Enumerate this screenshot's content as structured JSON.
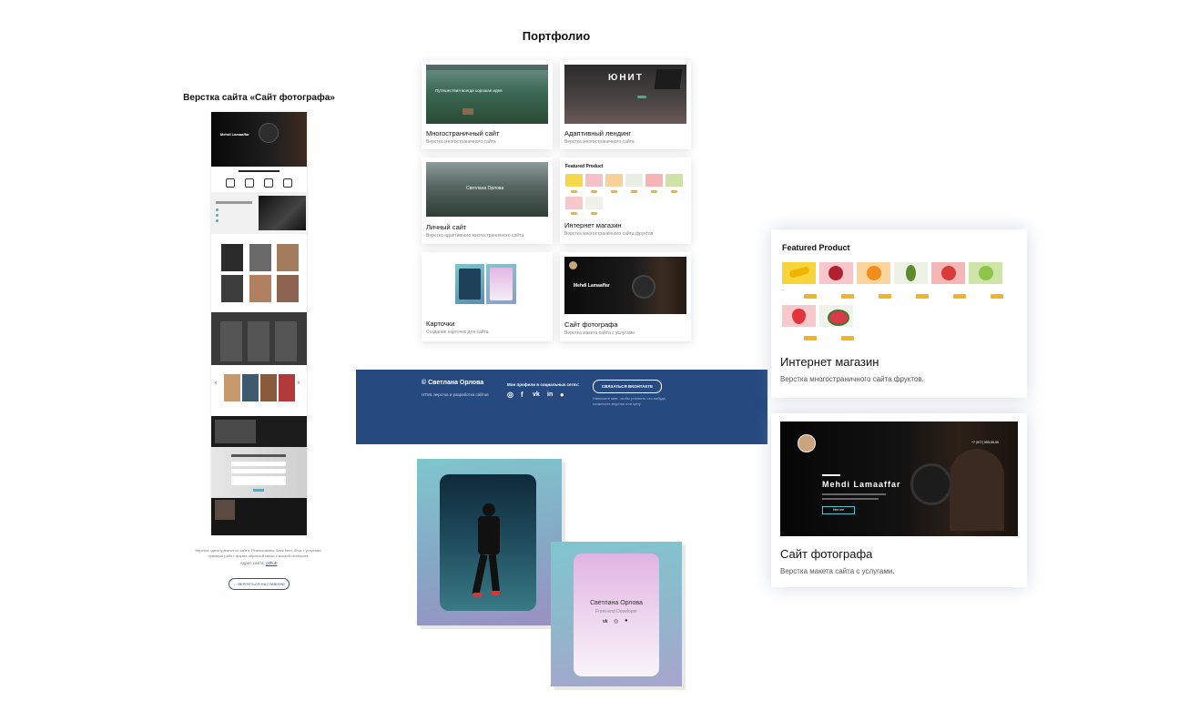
{
  "portfolio": {
    "title": "Портфолио",
    "cards": [
      {
        "title": "Многостраничный сайт",
        "subtitle": "Верстка многостраничного сайта",
        "thumb_text": "Путешествия всегда хорошая идея"
      },
      {
        "title": "Адаптивный лендинг",
        "subtitle": "Верстка многостраничного сайта",
        "thumb_text": "ЮНИТ"
      },
      {
        "title": "Личный сайт",
        "subtitle": "Верстка адаптивного многостраничного сайта",
        "thumb_text": "Светлана Орлова"
      },
      {
        "title": "Интернет магазин",
        "subtitle": "Верстка многостраничного сайта фруктов",
        "thumb_text": "Featured Product"
      },
      {
        "title": "Карточки",
        "subtitle": "Создание карточек для сайта"
      },
      {
        "title": "Сайт фотографа",
        "subtitle": "Верстка макета сайта с услугами",
        "thumb_text": "Mehdi Lamaaffar"
      }
    ]
  },
  "left_preview": {
    "title": "Верстка сайта «Сайт фотографа»",
    "hero_name": "Mehdi Lamaaffar",
    "description": "Верстка одностраничного сайта. Реализованы: блок hero, блок с услугами, примеры работ, форма обратной связи с маской телефона.",
    "link_prefix": "Адрес сайта:",
    "link_text": "github",
    "back_button": "← ВЕРНУТЬСЯ НА ГЛАВНУЮ"
  },
  "footer": {
    "copyright": "© Светлана Орлова",
    "tagline": "HTML верстка и разработка сайтов",
    "social_heading": "Мои профили в социальных сетях:",
    "cta_button": "СВЯЗАТЬСЯ ВКОНТАКТЕ",
    "cta_note": "Напишите мне, чтобы уточнить что-нибудь, сложность верстки или цену.",
    "bg_color": "#264a80"
  },
  "card_widget": {
    "name": "Светлана Орлова",
    "role": "Front-end Developer"
  },
  "big_cards": [
    {
      "heading": "Featured Product",
      "title": "Интернет магазин",
      "subtitle": "Верстка многостраничного сайта фруктов."
    },
    {
      "hero_name": "Mehdi Lamaaffar",
      "phone": "+7 (977) 555-55-55",
      "button": "Hire me",
      "title": "Сайт фотографа",
      "subtitle": "Верстка макета сайта с услугами."
    }
  ],
  "colors": {
    "accent_yellow": "#f0b429",
    "footer_blue": "#264a80",
    "card_gradient_a": "#7fc6cd",
    "card_gradient_b": "#e3b6e6"
  }
}
